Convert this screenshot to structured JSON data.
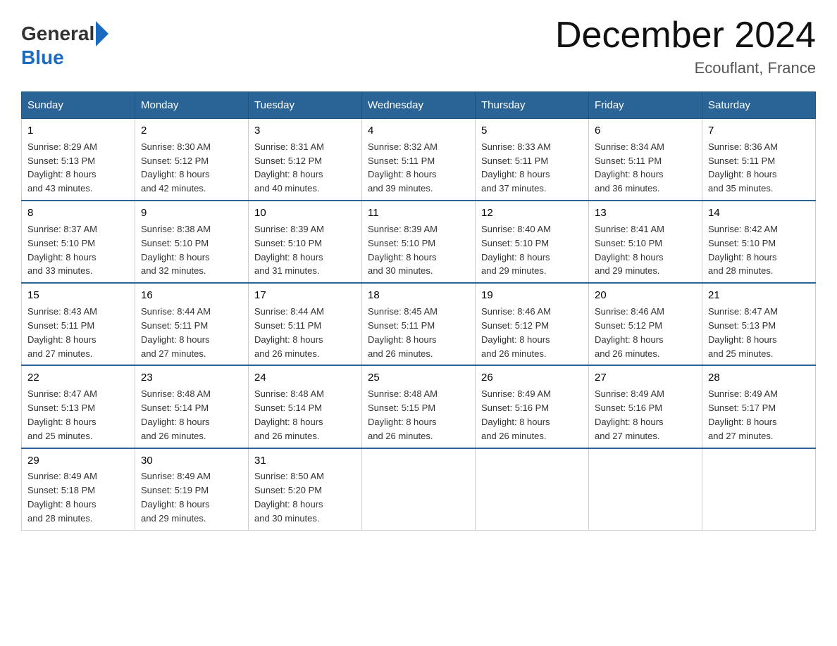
{
  "header": {
    "logo_general": "General",
    "logo_blue": "Blue",
    "main_title": "December 2024",
    "subtitle": "Ecouflant, France"
  },
  "days_of_week": [
    "Sunday",
    "Monday",
    "Tuesday",
    "Wednesday",
    "Thursday",
    "Friday",
    "Saturday"
  ],
  "weeks": [
    [
      {
        "day": "1",
        "sunrise": "8:29 AM",
        "sunset": "5:13 PM",
        "daylight": "8 hours and 43 minutes."
      },
      {
        "day": "2",
        "sunrise": "8:30 AM",
        "sunset": "5:12 PM",
        "daylight": "8 hours and 42 minutes."
      },
      {
        "day": "3",
        "sunrise": "8:31 AM",
        "sunset": "5:12 PM",
        "daylight": "8 hours and 40 minutes."
      },
      {
        "day": "4",
        "sunrise": "8:32 AM",
        "sunset": "5:11 PM",
        "daylight": "8 hours and 39 minutes."
      },
      {
        "day": "5",
        "sunrise": "8:33 AM",
        "sunset": "5:11 PM",
        "daylight": "8 hours and 37 minutes."
      },
      {
        "day": "6",
        "sunrise": "8:34 AM",
        "sunset": "5:11 PM",
        "daylight": "8 hours and 36 minutes."
      },
      {
        "day": "7",
        "sunrise": "8:36 AM",
        "sunset": "5:11 PM",
        "daylight": "8 hours and 35 minutes."
      }
    ],
    [
      {
        "day": "8",
        "sunrise": "8:37 AM",
        "sunset": "5:10 PM",
        "daylight": "8 hours and 33 minutes."
      },
      {
        "day": "9",
        "sunrise": "8:38 AM",
        "sunset": "5:10 PM",
        "daylight": "8 hours and 32 minutes."
      },
      {
        "day": "10",
        "sunrise": "8:39 AM",
        "sunset": "5:10 PM",
        "daylight": "8 hours and 31 minutes."
      },
      {
        "day": "11",
        "sunrise": "8:39 AM",
        "sunset": "5:10 PM",
        "daylight": "8 hours and 30 minutes."
      },
      {
        "day": "12",
        "sunrise": "8:40 AM",
        "sunset": "5:10 PM",
        "daylight": "8 hours and 29 minutes."
      },
      {
        "day": "13",
        "sunrise": "8:41 AM",
        "sunset": "5:10 PM",
        "daylight": "8 hours and 29 minutes."
      },
      {
        "day": "14",
        "sunrise": "8:42 AM",
        "sunset": "5:10 PM",
        "daylight": "8 hours and 28 minutes."
      }
    ],
    [
      {
        "day": "15",
        "sunrise": "8:43 AM",
        "sunset": "5:11 PM",
        "daylight": "8 hours and 27 minutes."
      },
      {
        "day": "16",
        "sunrise": "8:44 AM",
        "sunset": "5:11 PM",
        "daylight": "8 hours and 27 minutes."
      },
      {
        "day": "17",
        "sunrise": "8:44 AM",
        "sunset": "5:11 PM",
        "daylight": "8 hours and 26 minutes."
      },
      {
        "day": "18",
        "sunrise": "8:45 AM",
        "sunset": "5:11 PM",
        "daylight": "8 hours and 26 minutes."
      },
      {
        "day": "19",
        "sunrise": "8:46 AM",
        "sunset": "5:12 PM",
        "daylight": "8 hours and 26 minutes."
      },
      {
        "day": "20",
        "sunrise": "8:46 AM",
        "sunset": "5:12 PM",
        "daylight": "8 hours and 26 minutes."
      },
      {
        "day": "21",
        "sunrise": "8:47 AM",
        "sunset": "5:13 PM",
        "daylight": "8 hours and 25 minutes."
      }
    ],
    [
      {
        "day": "22",
        "sunrise": "8:47 AM",
        "sunset": "5:13 PM",
        "daylight": "8 hours and 25 minutes."
      },
      {
        "day": "23",
        "sunrise": "8:48 AM",
        "sunset": "5:14 PM",
        "daylight": "8 hours and 26 minutes."
      },
      {
        "day": "24",
        "sunrise": "8:48 AM",
        "sunset": "5:14 PM",
        "daylight": "8 hours and 26 minutes."
      },
      {
        "day": "25",
        "sunrise": "8:48 AM",
        "sunset": "5:15 PM",
        "daylight": "8 hours and 26 minutes."
      },
      {
        "day": "26",
        "sunrise": "8:49 AM",
        "sunset": "5:16 PM",
        "daylight": "8 hours and 26 minutes."
      },
      {
        "day": "27",
        "sunrise": "8:49 AM",
        "sunset": "5:16 PM",
        "daylight": "8 hours and 27 minutes."
      },
      {
        "day": "28",
        "sunrise": "8:49 AM",
        "sunset": "5:17 PM",
        "daylight": "8 hours and 27 minutes."
      }
    ],
    [
      {
        "day": "29",
        "sunrise": "8:49 AM",
        "sunset": "5:18 PM",
        "daylight": "8 hours and 28 minutes."
      },
      {
        "day": "30",
        "sunrise": "8:49 AM",
        "sunset": "5:19 PM",
        "daylight": "8 hours and 29 minutes."
      },
      {
        "day": "31",
        "sunrise": "8:50 AM",
        "sunset": "5:20 PM",
        "daylight": "8 hours and 30 minutes."
      },
      {
        "day": "",
        "sunrise": "",
        "sunset": "",
        "daylight": ""
      },
      {
        "day": "",
        "sunrise": "",
        "sunset": "",
        "daylight": ""
      },
      {
        "day": "",
        "sunrise": "",
        "sunset": "",
        "daylight": ""
      },
      {
        "day": "",
        "sunrise": "",
        "sunset": "",
        "daylight": ""
      }
    ]
  ],
  "labels": {
    "sunrise_prefix": "Sunrise: ",
    "sunset_prefix": "Sunset: ",
    "daylight_prefix": "Daylight: "
  }
}
